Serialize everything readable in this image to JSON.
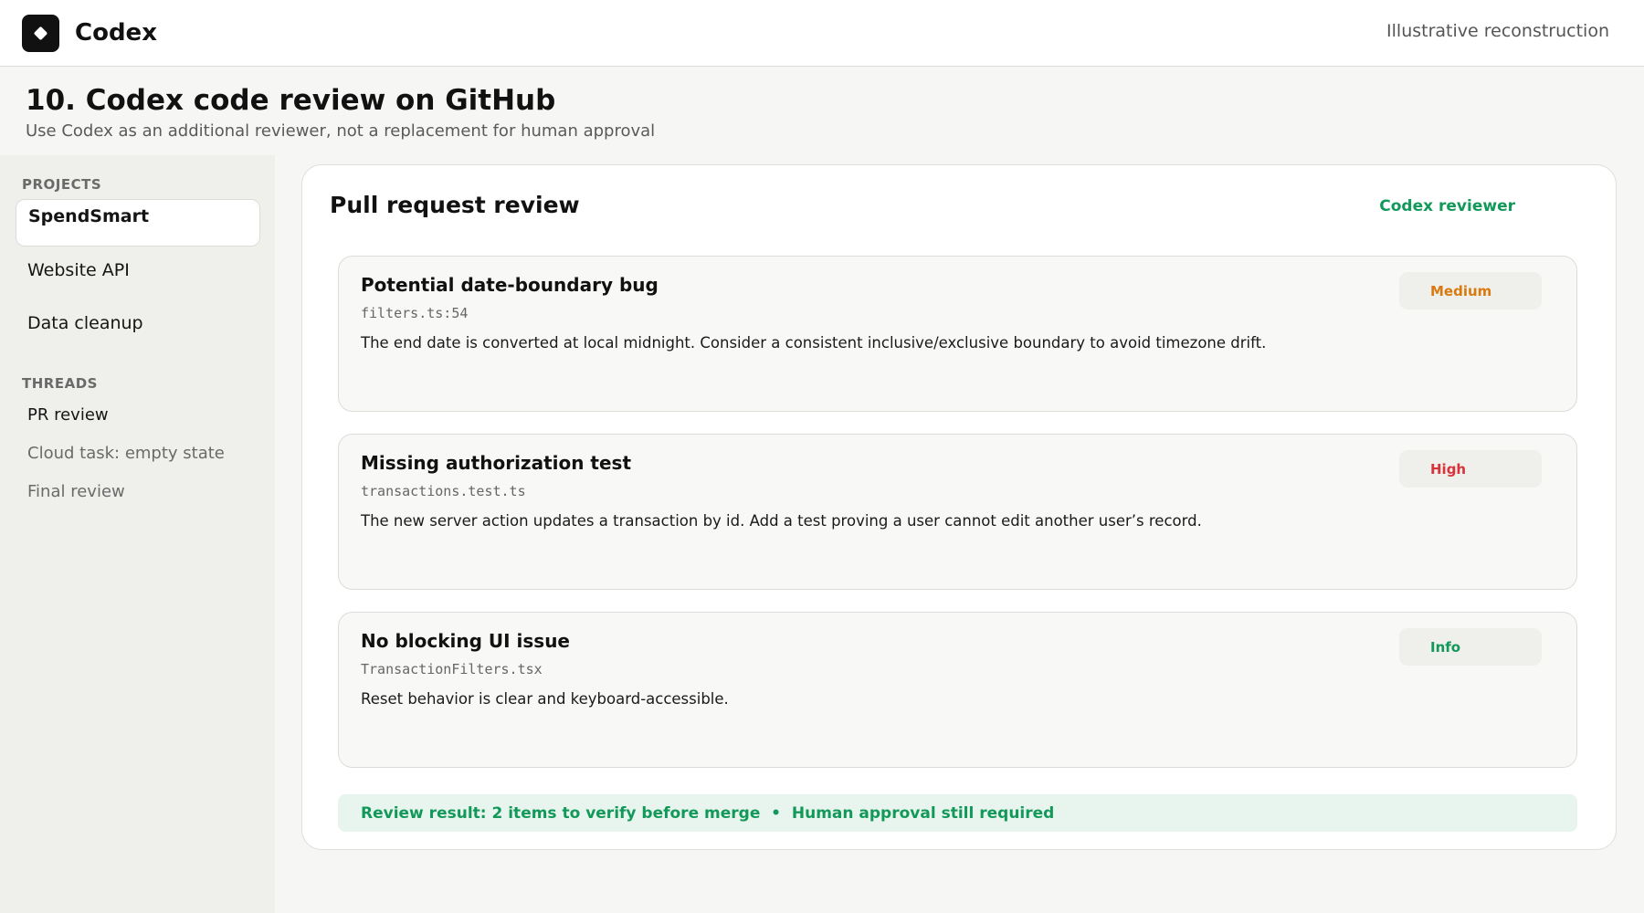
{
  "app": {
    "title": "Codex",
    "note": "Illustrative reconstruction",
    "logo_icon": "codex-logo-icon"
  },
  "page": {
    "title": "10. Codex code review on GitHub",
    "subtitle": "Use Codex as an additional reviewer, not a replacement for human approval"
  },
  "sidebar": {
    "projects_label": "PROJECTS",
    "projects": [
      {
        "label": "SpendSmart",
        "active": true
      },
      {
        "label": "Website API",
        "active": false
      },
      {
        "label": "Data cleanup",
        "active": false
      }
    ],
    "threads_label": "THREADS",
    "threads": [
      {
        "label": "PR review",
        "color": "#151515"
      },
      {
        "label": "Cloud task: empty state",
        "color": "#6a6a6a"
      },
      {
        "label": "Final review",
        "color": "#6a6a6a"
      }
    ]
  },
  "review": {
    "title": "Pull request review",
    "reviewer": "Codex reviewer",
    "findings": [
      {
        "title": "Potential date-boundary bug",
        "file": "filters.ts:54",
        "description": "The end date is converted at local midnight. Consider a consistent inclusive/exclusive boundary to avoid timezone drift.",
        "severity": "Medium",
        "severity_color": "#d97a10"
      },
      {
        "title": "Missing authorization test",
        "file": "transactions.test.ts",
        "description": "The new server action updates a transaction by id. Add a test proving a user cannot edit another user’s record.",
        "severity": "High",
        "severity_color": "#d8333a"
      },
      {
        "title": "No blocking UI issue",
        "file": "TransactionFilters.tsx",
        "description": "Reset behavior is clear and keyboard-accessible.",
        "severity": "Info",
        "severity_color": "#12995a"
      }
    ],
    "result": "Review result: 2 items to verify before merge  •  Human approval still required"
  },
  "colors": {
    "accent": "#12995a",
    "background": "#f6f6f4",
    "sidebar": "#efefeb"
  }
}
